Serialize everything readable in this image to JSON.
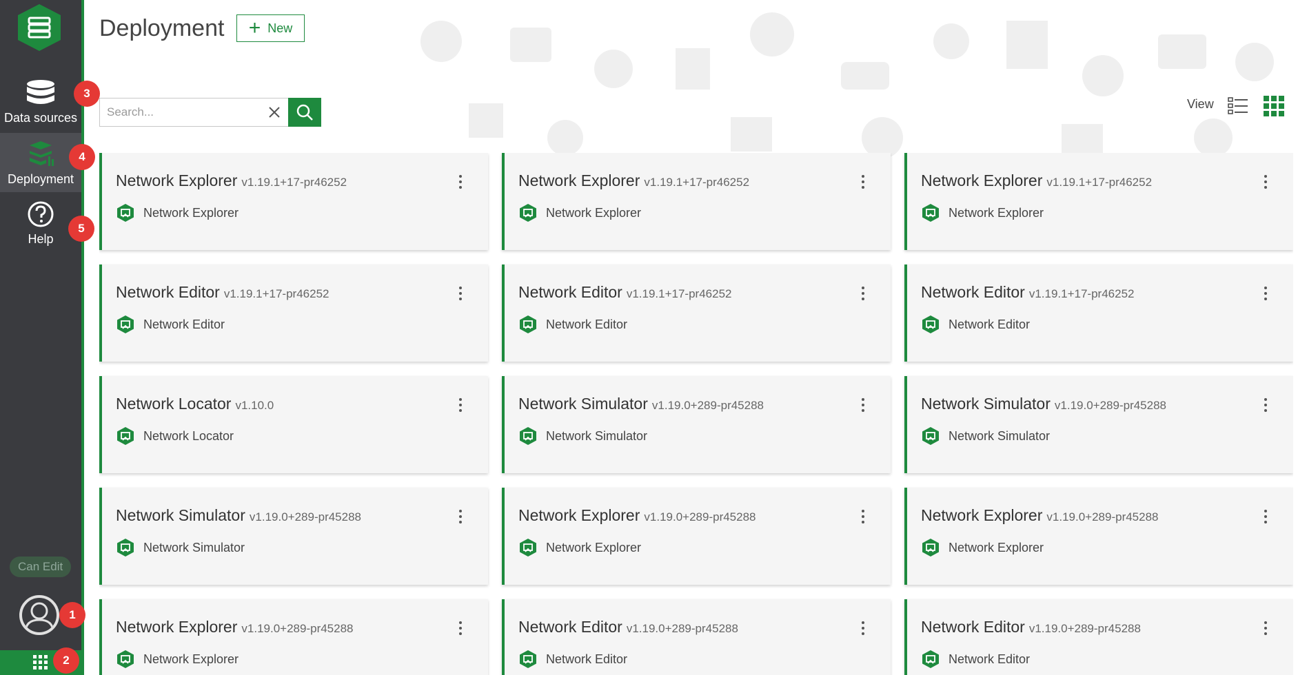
{
  "sidebar": {
    "items": [
      {
        "label": "Data sources",
        "icon": "database-icon",
        "badge": "3"
      },
      {
        "label": "Deployment",
        "icon": "deployment-icon",
        "badge": "4",
        "active": true
      },
      {
        "label": "Help",
        "icon": "help-icon",
        "badge": "5"
      }
    ],
    "can_edit_label": "Can Edit",
    "avatar_badge": "1",
    "apps_badge": "2"
  },
  "header": {
    "title": "Deployment",
    "new_label": "New"
  },
  "search": {
    "placeholder": "Search...",
    "value": ""
  },
  "view": {
    "label": "View",
    "mode": "grid"
  },
  "colors": {
    "accent": "#1e8a3e",
    "sidebar_bg": "#3a3b3f",
    "badge": "#e53935"
  },
  "cards": [
    {
      "title": "Network Explorer",
      "version": "v1.19.1+17-pr46252",
      "app": "Network Explorer"
    },
    {
      "title": "Network Explorer",
      "version": "v1.19.1+17-pr46252",
      "app": "Network Explorer"
    },
    {
      "title": "Network Explorer",
      "version": "v1.19.1+17-pr46252",
      "app": "Network Explorer"
    },
    {
      "title": "Network Editor",
      "version": "v1.19.1+17-pr46252",
      "app": "Network Editor"
    },
    {
      "title": "Network Editor",
      "version": "v1.19.1+17-pr46252",
      "app": "Network Editor"
    },
    {
      "title": "Network Editor",
      "version": "v1.19.1+17-pr46252",
      "app": "Network Editor"
    },
    {
      "title": "Network Locator",
      "version": "v1.10.0",
      "app": "Network Locator"
    },
    {
      "title": "Network Simulator",
      "version": "v1.19.0+289-pr45288",
      "app": "Network Simulator"
    },
    {
      "title": "Network Simulator",
      "version": "v1.19.0+289-pr45288",
      "app": "Network Simulator"
    },
    {
      "title": "Network Simulator",
      "version": "v1.19.0+289-pr45288",
      "app": "Network Simulator"
    },
    {
      "title": "Network Explorer",
      "version": "v1.19.0+289-pr45288",
      "app": "Network Explorer"
    },
    {
      "title": "Network Explorer",
      "version": "v1.19.0+289-pr45288",
      "app": "Network Explorer"
    },
    {
      "title": "Network Explorer",
      "version": "v1.19.0+289-pr45288",
      "app": "Network Explorer"
    },
    {
      "title": "Network Editor",
      "version": "v1.19.0+289-pr45288",
      "app": "Network Editor"
    },
    {
      "title": "Network Editor",
      "version": "v1.19.0+289-pr45288",
      "app": "Network Editor"
    }
  ]
}
